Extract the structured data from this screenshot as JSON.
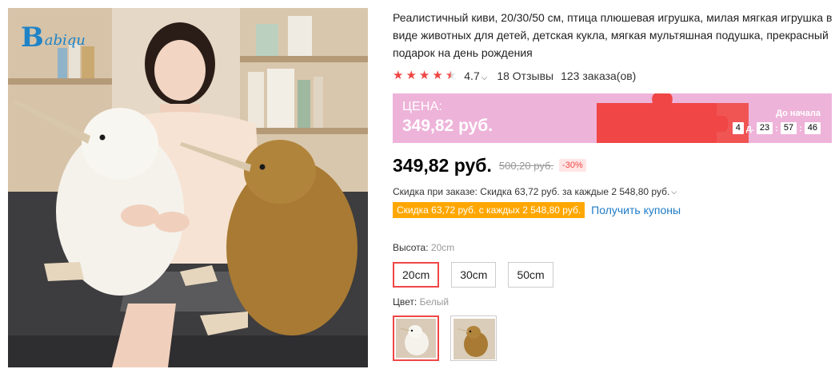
{
  "logo": {
    "b": "B",
    "rest": "abiqu"
  },
  "product": {
    "title": "Реалистичный киви, 20/30/50 см, птица плюшевая игрушка, милая мягкая игрушка в виде животных для детей, детская кукла, мягкая мультяшная подушка, прекрасный подарок на день рождения",
    "rating": 4.7,
    "rating_text": "4.7",
    "reviews": "18 Отзывы",
    "orders": "123 заказа(ов)"
  },
  "promo": {
    "label": "ЦЕНА:",
    "price": "349,82 руб.",
    "countdown_label": "До начала",
    "days": "4",
    "days_unit": "д.",
    "hours": "23",
    "minutes": "57",
    "seconds": "46"
  },
  "price": {
    "current": "349,82 руб.",
    "old": "500,20 руб.",
    "discount": "-30%"
  },
  "store_discount": {
    "text": "Скидка при заказе: Скидка 63,72 руб. за каждые 2 548,80 руб.",
    "badge": "Скидка 63,72 руб. с каждых 2 548,80 руб.",
    "coupon_link": "Получить купоны"
  },
  "height_prop": {
    "label": "Высота:",
    "selected": "20cm",
    "options": [
      "20cm",
      "30cm",
      "50cm"
    ]
  },
  "color_prop": {
    "label": "Цвет:",
    "selected": "Белый"
  },
  "colors": {
    "accent": "#f04645",
    "promo_bg": "#eeb3d9",
    "coupon": "#ffa700",
    "link": "#1e7bc6"
  },
  "icons": [
    "star-icon",
    "chevron-down-icon"
  ]
}
